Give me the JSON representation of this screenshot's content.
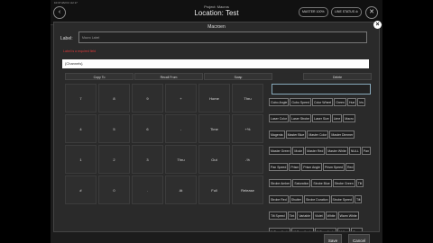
{
  "status_bar": {
    "left": "10:37 AM   Fri Jul 17"
  },
  "header": {
    "project": "Project: Macros",
    "location": "Location: Test",
    "master_pill": "MASTER 100%",
    "line_status_pill": "LINE STATUS ⊘"
  },
  "dialog": {
    "title": "Macroen",
    "label_caption": "Label:",
    "label_placeholder": "Macro Label",
    "error": "Label is a required field",
    "channels_value": "{Channels}"
  },
  "actions": [
    "Copy To",
    "Recall From",
    "Swap",
    "Delete"
  ],
  "keypad": [
    [
      "7",
      "8",
      "9",
      "+",
      "Home",
      "Thru"
    ],
    [
      "4",
      "5",
      "6",
      "-",
      "Time",
      "+%"
    ],
    [
      "1",
      "2",
      "3",
      "Thru",
      "Out",
      "-%"
    ],
    [
      "#",
      "0",
      ".",
      "At",
      "Full",
      "Release"
    ]
  ],
  "parameters": [
    "Gobo Angle",
    "Gobo Speed",
    "Color Wheel",
    "Green",
    "Hue",
    "Iris",
    "Laser Color",
    "Laser Strobe",
    "Laser Size",
    "Lime",
    "Macro",
    "Magenta",
    "Master Blue",
    "Master Color",
    "Master Dimmer",
    "Master Green",
    "Mode",
    "Master Red",
    "Master White",
    "NULL",
    "Pan",
    "Pan Speed",
    "Prism",
    "Prism Angle",
    "Prism Speed",
    "Red",
    "Strobe Amber",
    "Saturation",
    "Strobe Blue",
    "Strobe Green",
    "Tilt",
    "Strobe Red",
    "Shutter",
    "Strobe Duration",
    "Strobe Speed",
    "Tilt",
    "Tilt Speed",
    "Tint",
    "Variable",
    "Violet",
    "White",
    "Warm White",
    "X Coordinate",
    "X Coordinate",
    "Y Coordinate",
    "Yellow",
    "Zoom",
    "Zoom Control"
  ],
  "footer": {
    "save": "Save",
    "cancel": "Cancel"
  },
  "colors": {
    "error": "#e03a3a",
    "accent_outline": "#88aabb"
  }
}
